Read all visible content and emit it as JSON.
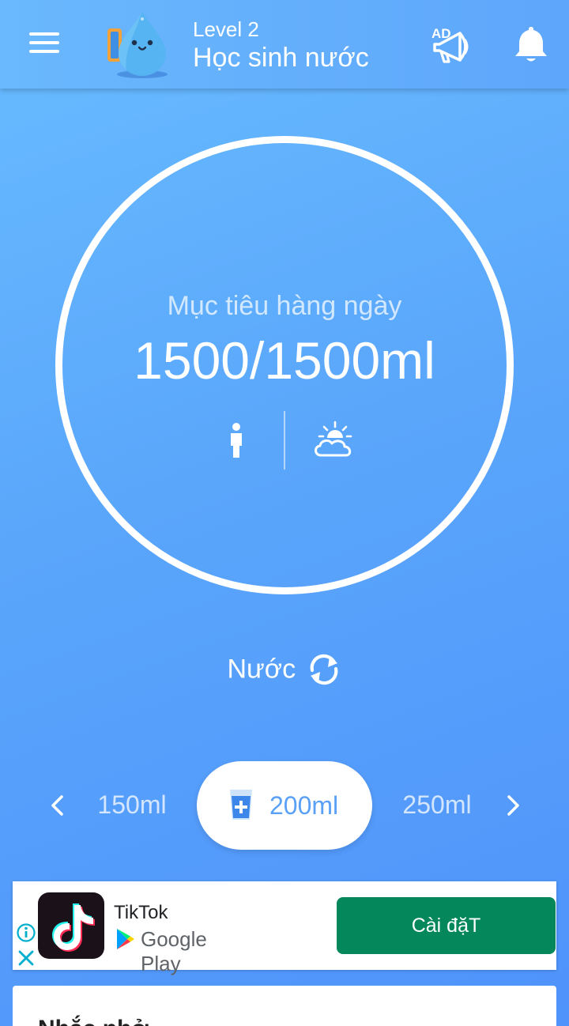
{
  "header": {
    "level": "Level 2",
    "title": "Học sinh nước",
    "icons": [
      "menu-icon",
      "mascot-icon",
      "ad-megaphone-icon",
      "bell-icon"
    ],
    "ad_badge": "AD"
  },
  "goal": {
    "label": "Mục tiêu hàng ngày",
    "value": "1500/1500ml",
    "progress_fraction": 1.0,
    "icons": [
      "person-icon",
      "weather-icon"
    ]
  },
  "drink": {
    "name": "Nước",
    "icon": "swap-icon"
  },
  "cups": {
    "prev": "150ml",
    "selected": "200ml",
    "next": "250ml"
  },
  "ad": {
    "app_name": "TikTok",
    "store": "Google Play",
    "install_label": "Cài đặT"
  },
  "reminder": {
    "title": "Nhắc nhở"
  },
  "colors": {
    "background_top": "#68bcff",
    "background_bottom": "#4f93fb",
    "install_button": "#04875b",
    "selected_text": "#5aa0f7"
  }
}
